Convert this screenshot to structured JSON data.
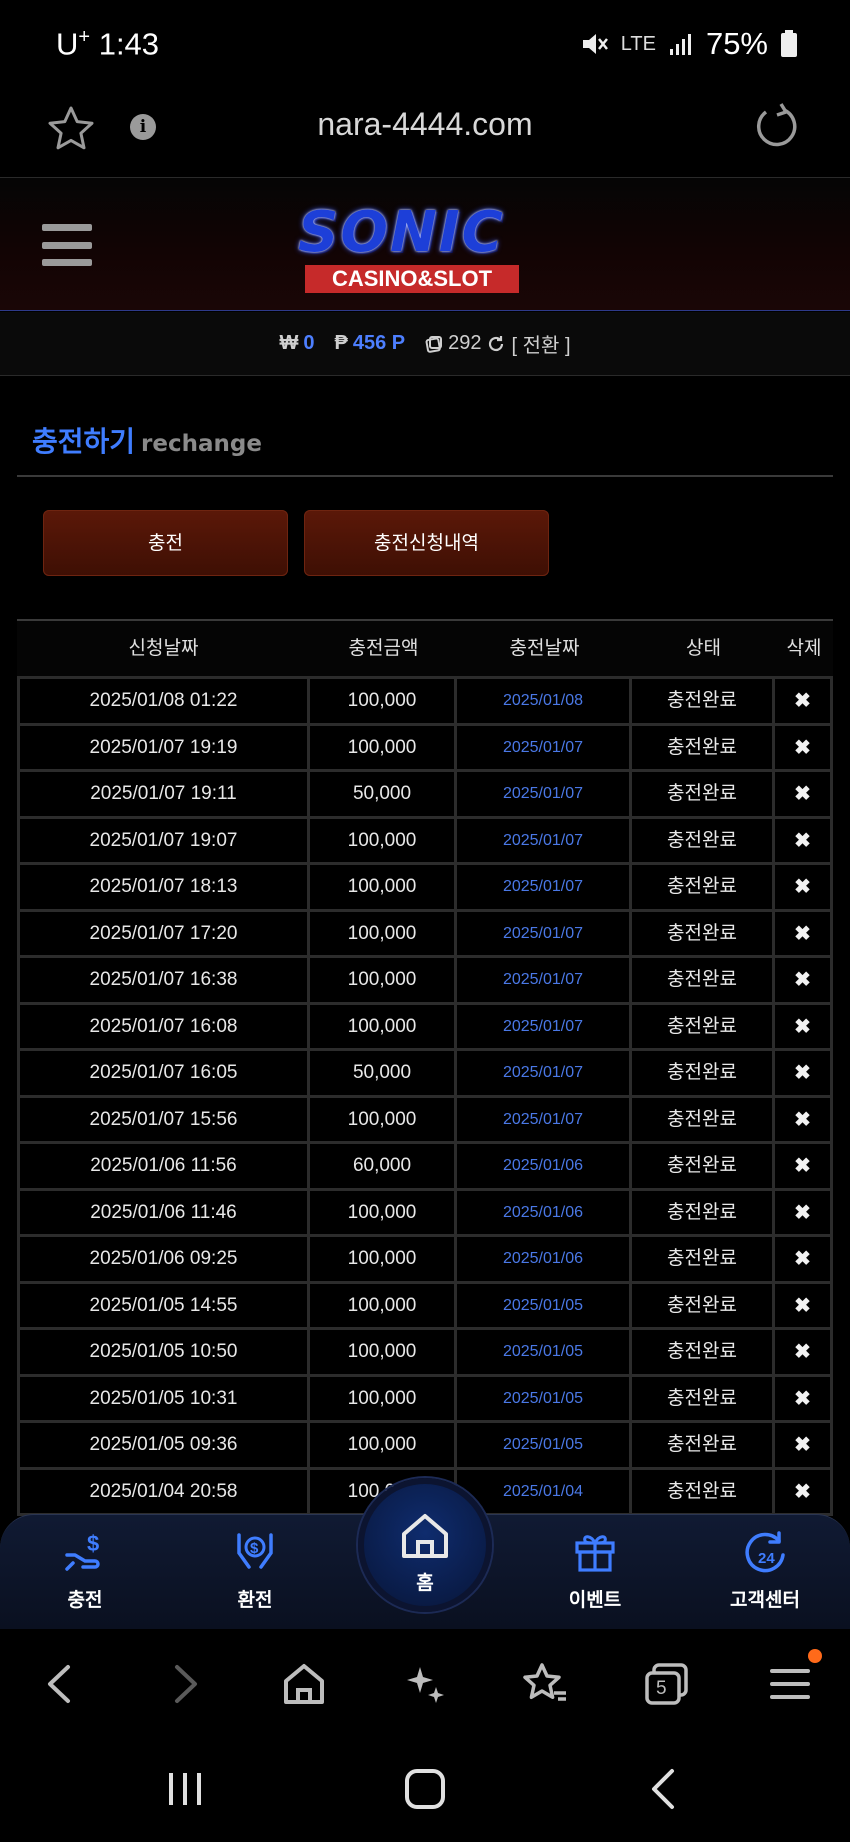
{
  "status": {
    "carrier": "U",
    "carrier_sup": "+",
    "time": "1:43",
    "network": "LTE",
    "battery": "75%"
  },
  "browser": {
    "url": "nara-4444.com",
    "tabs_count": "5"
  },
  "site": {
    "logo_main": "SONIC",
    "logo_sub": "CASINO&SLOT"
  },
  "balance": {
    "won_symbol": "₩",
    "won_value": "0",
    "point_symbol": "₱",
    "point_value": "456 P",
    "chip_value": "292",
    "convert_label": "[ 전환 ]"
  },
  "page": {
    "title": "충전하기",
    "subtitle": "rechange"
  },
  "tabs": [
    "충전",
    "충전신청내역"
  ],
  "table": {
    "headers": [
      "신청날짜",
      "충전금액",
      "충전날짜",
      "상태",
      "삭제"
    ],
    "rows": [
      {
        "request_date": "2025/01/08 01:22",
        "amount": "100,000",
        "charge_date": "2025/01/08",
        "status": "충전완료",
        "delete": "✖"
      },
      {
        "request_date": "2025/01/07 19:19",
        "amount": "100,000",
        "charge_date": "2025/01/07",
        "status": "충전완료",
        "delete": "✖"
      },
      {
        "request_date": "2025/01/07 19:11",
        "amount": "50,000",
        "charge_date": "2025/01/07",
        "status": "충전완료",
        "delete": "✖"
      },
      {
        "request_date": "2025/01/07 19:07",
        "amount": "100,000",
        "charge_date": "2025/01/07",
        "status": "충전완료",
        "delete": "✖"
      },
      {
        "request_date": "2025/01/07 18:13",
        "amount": "100,000",
        "charge_date": "2025/01/07",
        "status": "충전완료",
        "delete": "✖"
      },
      {
        "request_date": "2025/01/07 17:20",
        "amount": "100,000",
        "charge_date": "2025/01/07",
        "status": "충전완료",
        "delete": "✖"
      },
      {
        "request_date": "2025/01/07 16:38",
        "amount": "100,000",
        "charge_date": "2025/01/07",
        "status": "충전완료",
        "delete": "✖"
      },
      {
        "request_date": "2025/01/07 16:08",
        "amount": "100,000",
        "charge_date": "2025/01/07",
        "status": "충전완료",
        "delete": "✖"
      },
      {
        "request_date": "2025/01/07 16:05",
        "amount": "50,000",
        "charge_date": "2025/01/07",
        "status": "충전완료",
        "delete": "✖"
      },
      {
        "request_date": "2025/01/07 15:56",
        "amount": "100,000",
        "charge_date": "2025/01/07",
        "status": "충전완료",
        "delete": "✖"
      },
      {
        "request_date": "2025/01/06 11:56",
        "amount": "60,000",
        "charge_date": "2025/01/06",
        "status": "충전완료",
        "delete": "✖"
      },
      {
        "request_date": "2025/01/06 11:46",
        "amount": "100,000",
        "charge_date": "2025/01/06",
        "status": "충전완료",
        "delete": "✖"
      },
      {
        "request_date": "2025/01/06 09:25",
        "amount": "100,000",
        "charge_date": "2025/01/06",
        "status": "충전완료",
        "delete": "✖"
      },
      {
        "request_date": "2025/01/05 14:55",
        "amount": "100,000",
        "charge_date": "2025/01/05",
        "status": "충전완료",
        "delete": "✖"
      },
      {
        "request_date": "2025/01/05 10:50",
        "amount": "100,000",
        "charge_date": "2025/01/05",
        "status": "충전완료",
        "delete": "✖"
      },
      {
        "request_date": "2025/01/05 10:31",
        "amount": "100,000",
        "charge_date": "2025/01/05",
        "status": "충전완료",
        "delete": "✖"
      },
      {
        "request_date": "2025/01/05 09:36",
        "amount": "100,000",
        "charge_date": "2025/01/05",
        "status": "충전완료",
        "delete": "✖"
      },
      {
        "request_date": "2025/01/04 20:58",
        "amount": "100,000",
        "charge_date": "2025/01/04",
        "status": "충전완료",
        "delete": "✖"
      }
    ]
  },
  "bottom_nav": {
    "charge": "충전",
    "exchange": "환전",
    "home": "홈",
    "event": "이벤트",
    "support": "고객센터",
    "support_badge": "24"
  },
  "colors": {
    "accent_blue": "#3f7dff",
    "tab_brown": "#5b1808",
    "logo_red": "#c62a2a",
    "nav_blue": "#0a1c48"
  }
}
